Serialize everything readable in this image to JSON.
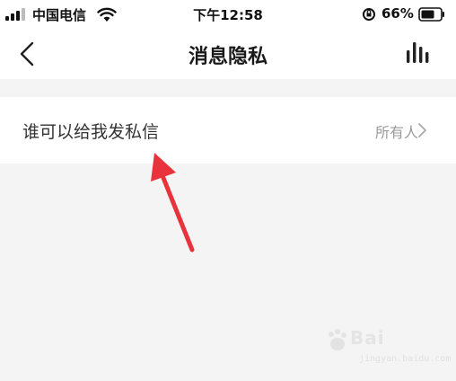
{
  "status_bar": {
    "carrier": "中国电信",
    "time": "下午12:58",
    "battery": "66%"
  },
  "nav": {
    "title": "消息隐私",
    "back_icon": "chevron-left-icon",
    "right_icon": "bar-chart-icon"
  },
  "setting": {
    "label": "谁可以给我发私信",
    "value": "所有人",
    "chevron_icon": "chevron-right-icon"
  },
  "annotation": {
    "color": "#e8333c"
  },
  "watermark": {
    "brand": "Bai",
    "url": "jingyan.baidu.com"
  }
}
